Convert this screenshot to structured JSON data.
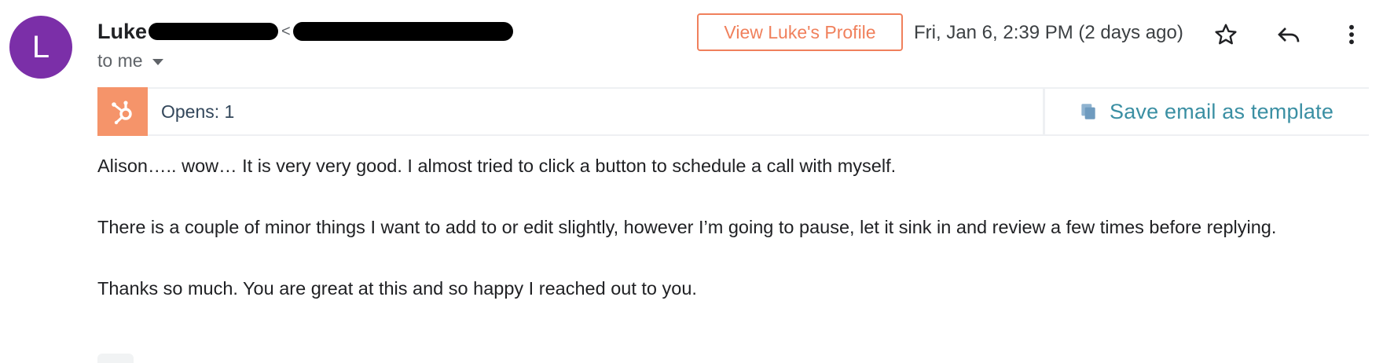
{
  "sender": {
    "avatar_letter": "L",
    "avatar_color": "#7b2fa8",
    "name": "Luke",
    "email_open_bracket": "<",
    "to_label": "to me"
  },
  "header": {
    "profile_button": "View Luke's Profile",
    "date": "Fri, Jan 6, 2:39 PM (2 days ago)",
    "icons": [
      "star-icon",
      "reply-icon",
      "more-vert-icon"
    ]
  },
  "hubspot": {
    "logo_icon": "hubspot-sprocket-icon",
    "opens": "Opens: 1",
    "save_template": "Save email as template",
    "accent": "#f5946a",
    "link_color": "#3a8fa3"
  },
  "body": {
    "p1": "Alison….. wow… It is very very good. I almost tried to click a button to schedule a call with myself.",
    "p2": "There is a couple of minor things I want to add to or edit slightly, however I’m going to pause, let it sink in and review a few times before replying.",
    "p3": "Thanks so much. You are great at this and so happy I reached out to you."
  }
}
